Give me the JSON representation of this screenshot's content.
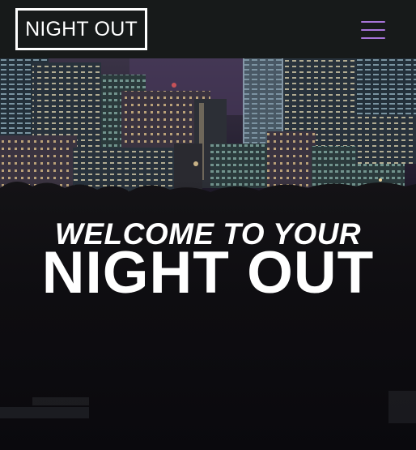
{
  "navbar": {
    "logo_text": "NIGHT OUT",
    "menu_icon": "hamburger-menu-icon"
  },
  "hero": {
    "line1": "WELCOME TO YOUR",
    "line2": "NIGHT OUT",
    "background": "night-city-skyline-image"
  },
  "colors": {
    "navbar_bg": "#171a1a",
    "accent": "#a774d9",
    "text": "#ffffff"
  }
}
